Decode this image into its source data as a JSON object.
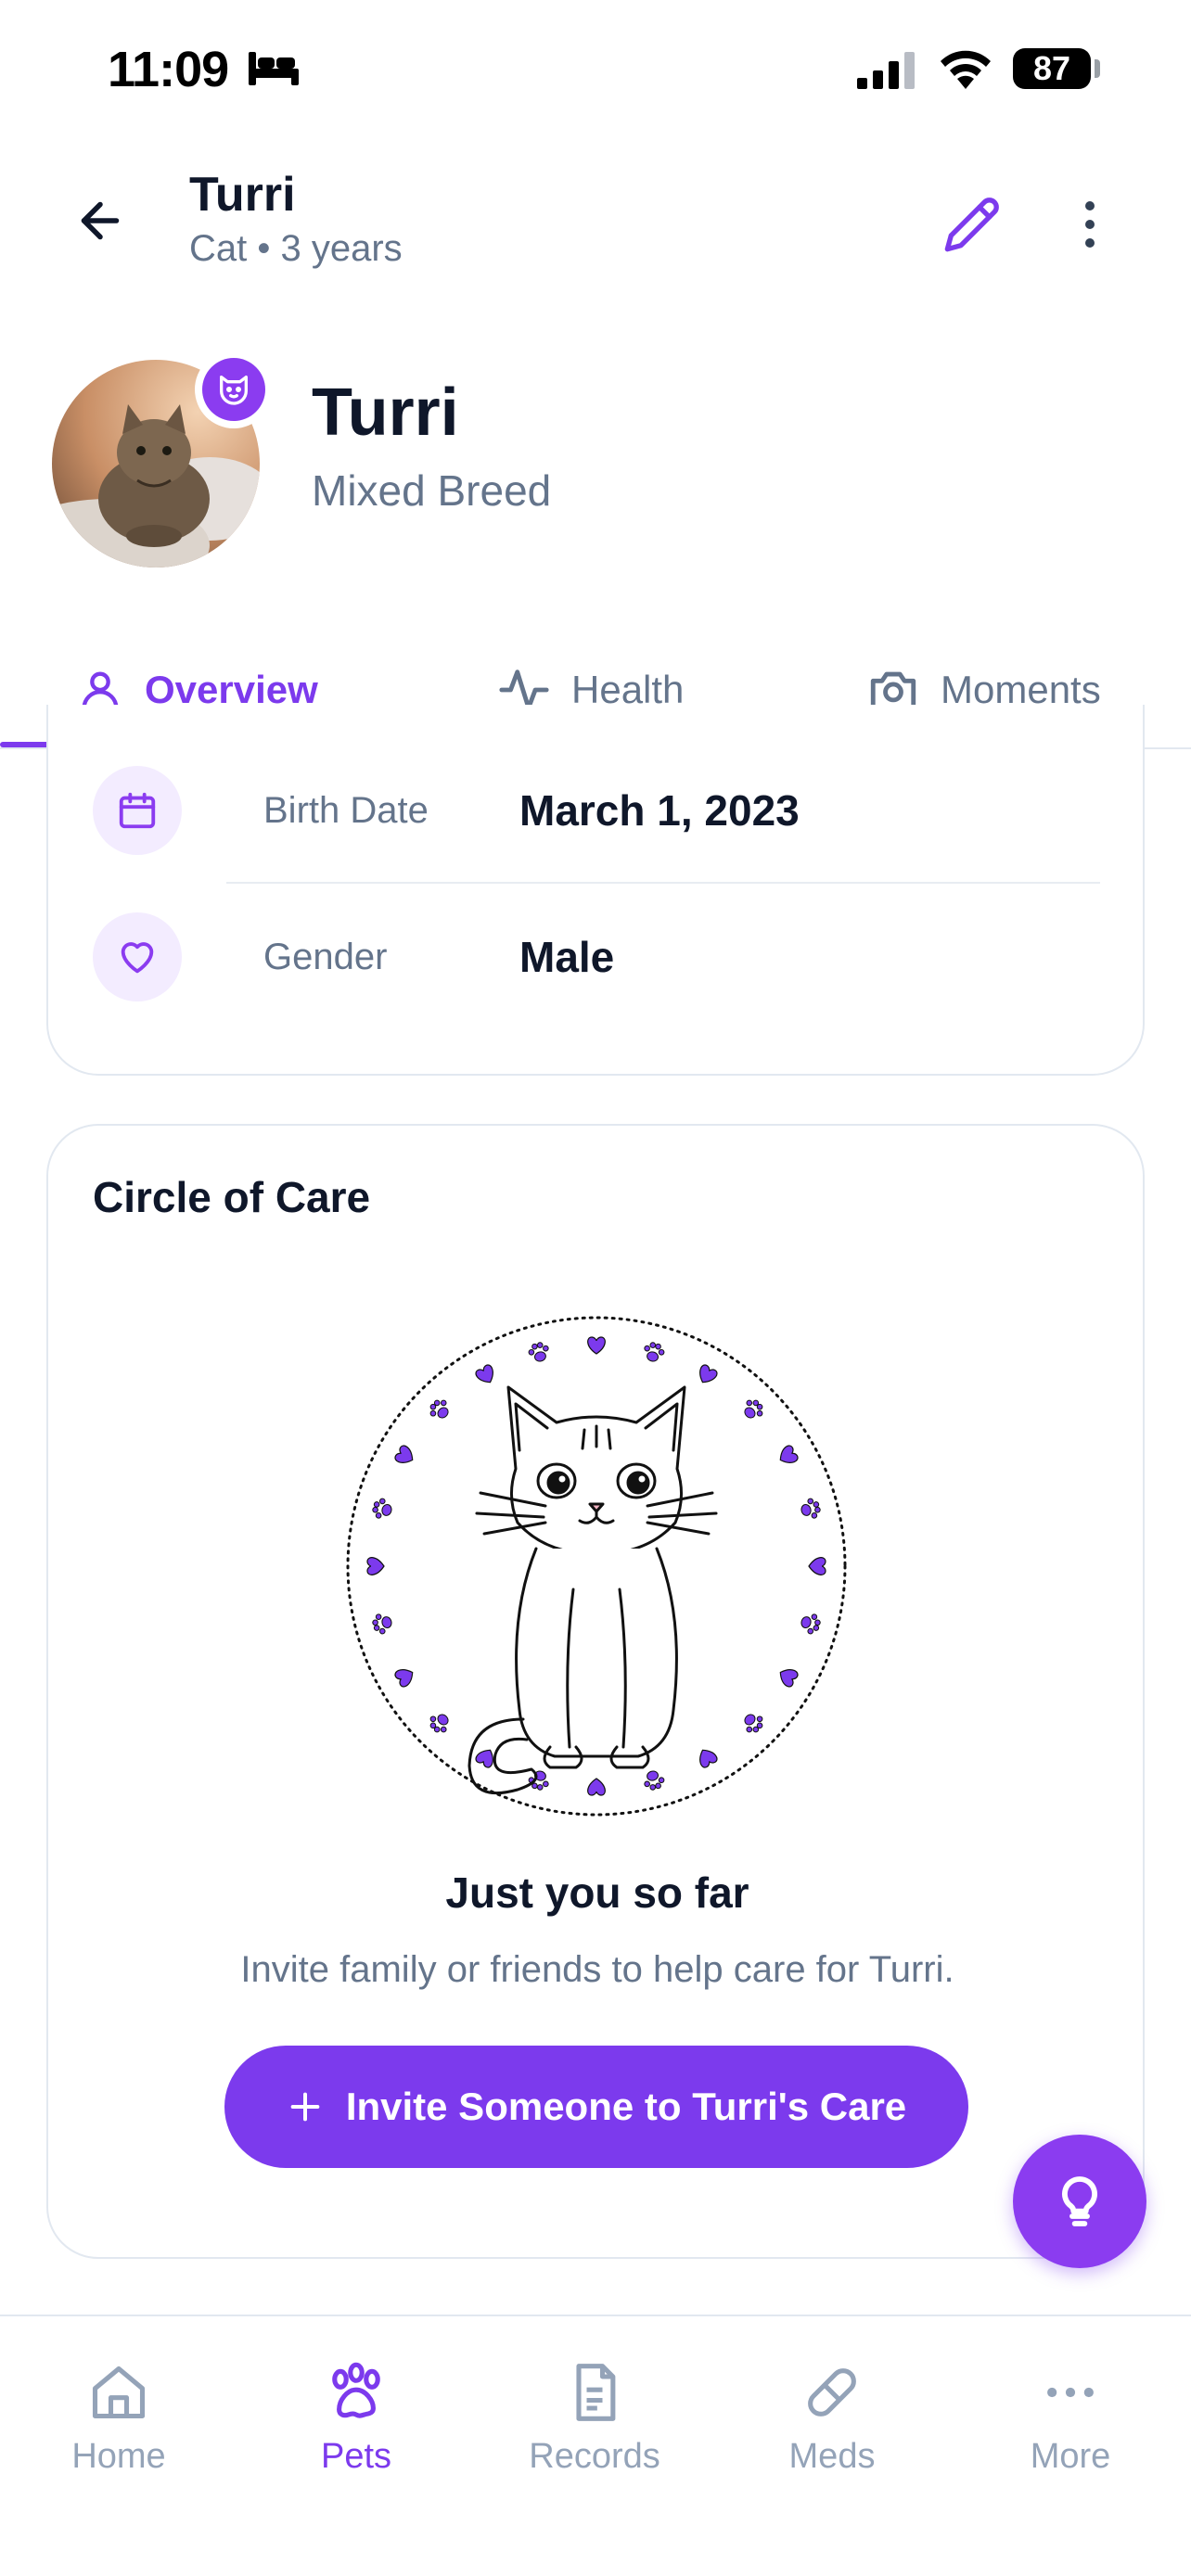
{
  "status_bar": {
    "time": "11:09",
    "battery": "87"
  },
  "header": {
    "title": "Turri",
    "subtitle": "Cat • 3 years"
  },
  "profile": {
    "name": "Turri",
    "breed": "Mixed Breed"
  },
  "tabs": [
    {
      "label": "Overview",
      "active": true
    },
    {
      "label": "Health",
      "active": false
    },
    {
      "label": "Moments",
      "active": false
    }
  ],
  "info": [
    {
      "label": "Birth Date",
      "value": "March 1, 2023",
      "icon": "calendar-icon"
    },
    {
      "label": "Gender",
      "value": "Male",
      "icon": "heart-icon"
    }
  ],
  "care": {
    "title": "Circle of Care",
    "headline": "Just you so far",
    "description": "Invite family or friends to help care for Turri.",
    "invite_label": "Invite Someone to Turri's Care"
  },
  "nav": [
    {
      "label": "Home",
      "icon": "home-icon",
      "active": false
    },
    {
      "label": "Pets",
      "icon": "paw-icon",
      "active": true
    },
    {
      "label": "Records",
      "icon": "document-icon",
      "active": false
    },
    {
      "label": "Meds",
      "icon": "pill-icon",
      "active": false
    },
    {
      "label": "More",
      "icon": "ellipsis-icon",
      "active": false
    }
  ],
  "colors": {
    "accent": "#7c3aed",
    "muted": "#64748b",
    "text": "#0f172a"
  }
}
